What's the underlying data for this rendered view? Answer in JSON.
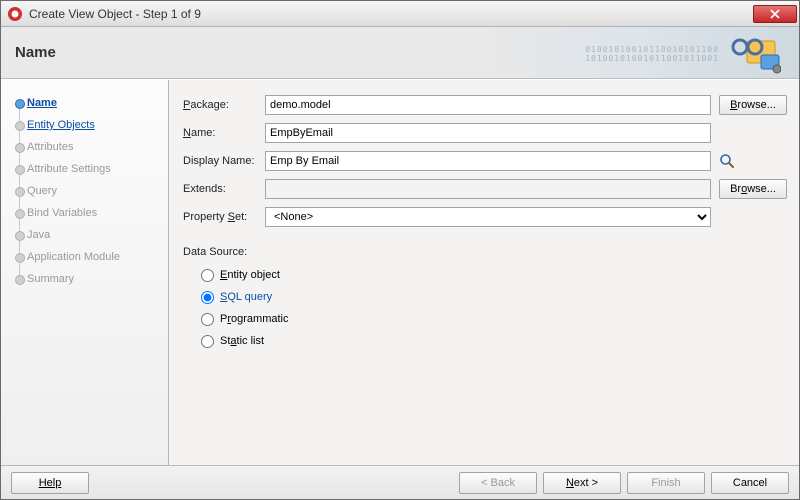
{
  "window": {
    "title": "Create View Object - Step 1 of 9"
  },
  "header": {
    "step_title": "Name"
  },
  "sidebar": {
    "steps": [
      {
        "label": "Name"
      },
      {
        "label": "Entity Objects"
      },
      {
        "label": "Attributes"
      },
      {
        "label": "Attribute Settings"
      },
      {
        "label": "Query"
      },
      {
        "label": "Bind Variables"
      },
      {
        "label": "Java"
      },
      {
        "label": "Application Module"
      },
      {
        "label": "Summary"
      }
    ]
  },
  "form": {
    "package_label": "Package:",
    "package_value": "demo.model",
    "name_label": "Name:",
    "name_value": "EmpByEmail",
    "display_label": "Display Name:",
    "display_value": "Emp By Email",
    "extends_label": "Extends:",
    "extends_value": "",
    "propset_label": "Property Set:",
    "propset_value": "<None>",
    "browse_label": "Browse...",
    "datasource_label": "Data Source:",
    "radios": {
      "entity": "Entity object",
      "sql": "SQL query",
      "prog": "Programmatic",
      "static": "Static list"
    }
  },
  "footer": {
    "help": "Help",
    "back": "< Back",
    "next": "Next >",
    "finish": "Finish",
    "cancel": "Cancel"
  }
}
